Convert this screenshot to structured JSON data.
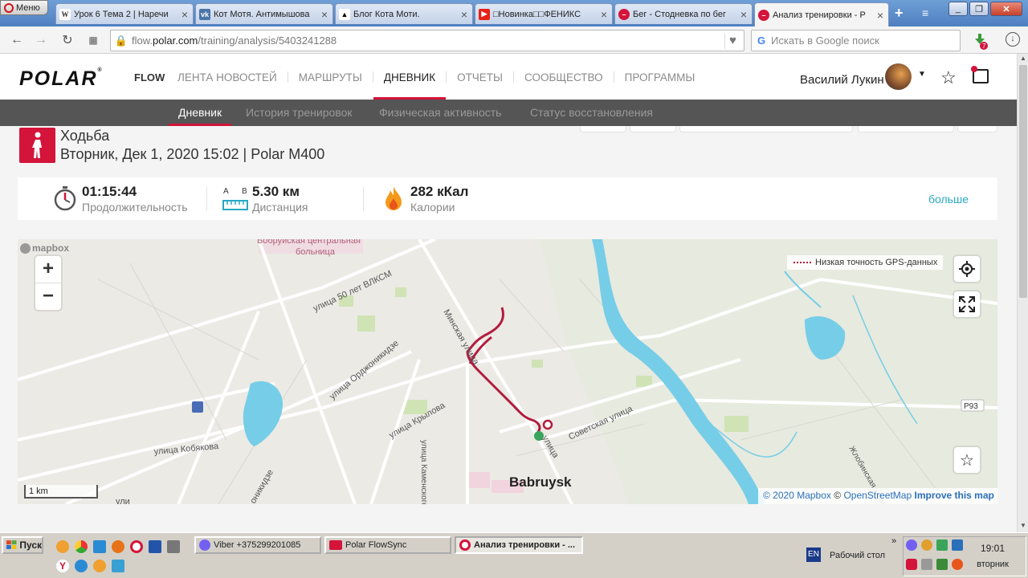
{
  "browser": {
    "menu_label": "Меню",
    "tabs": [
      {
        "title": "Урок 6 Тема 2 | Наречи",
        "icon": "wikipedia-icon"
      },
      {
        "title": "Кот Мотя. Антимышова",
        "icon": "vk-icon"
      },
      {
        "title": "Блог Кота Моти.",
        "icon": "cat-icon"
      },
      {
        "title": "□Новинка□□ФЕНИКС",
        "icon": "youtube-icon"
      },
      {
        "title": "Бег - Стодневка по бег",
        "icon": "red-circle-icon"
      },
      {
        "title": "Анализ тренировки - Р",
        "icon": "polar-icon"
      }
    ],
    "url_prefix": "flow.",
    "url_domain": "polar.com",
    "url_path": "/training/analysis/5403241288",
    "search_placeholder": "Искать в Google поиск"
  },
  "site": {
    "logo_text": "POLAR",
    "flow_label": "FLOW",
    "nav": [
      {
        "label": "ЛЕНТА НОВОСТЕЙ",
        "active": false
      },
      {
        "label": "МАРШРУТЫ",
        "active": false
      },
      {
        "label": "ДНЕВНИК",
        "active": true
      },
      {
        "label": "ОТЧЕТЫ",
        "active": false
      },
      {
        "label": "СООБЩЕСТВО",
        "active": false
      },
      {
        "label": "ПРОГРАММЫ",
        "active": false
      }
    ],
    "user_name": "Василий Лукин",
    "subnav": [
      {
        "label": "Дневник",
        "active": true
      },
      {
        "label": "История тренировок",
        "active": false
      },
      {
        "label": "Физическая активность",
        "active": false
      },
      {
        "label": "Статус восстановления",
        "active": false
      }
    ]
  },
  "activity": {
    "sport": "Ходьба",
    "date_line": "Вторник, Дек 1, 2020 15:02 | Polar M400",
    "stats": [
      {
        "value": "01:15:44",
        "label": "Продолжительность",
        "icon": "stopwatch-icon"
      },
      {
        "value": "5.30 км",
        "label": "Дистанция",
        "icon": "ruler-icon"
      },
      {
        "value": "282 кКал",
        "label": "Калории",
        "icon": "flame-icon"
      }
    ],
    "more_label": "больше",
    "ruler_a": "A",
    "ruler_b": "B"
  },
  "map": {
    "attribution_logo": "mapbox",
    "legend": "Низкая точность GPS-данных",
    "scale": "1 km",
    "city": "Babruysk",
    "road_badge": "P93",
    "labels": [
      "Бобруйская центральная",
      "больница",
      "улица 50 лет ВЛКСМ",
      "улица Орджоникидзе",
      "улица Крылова",
      "улица Кобякова",
      "Минская улица",
      "улица Каменского",
      "Советская улица",
      "улица",
      "Жлобинская улица",
      "оникидзе",
      "ули"
    ],
    "attrib_year": "© 2020 Mapbox",
    "attrib_osm": "OpenStreetMap",
    "attrib_improve": "Improve this map",
    "attrib_sep": "©"
  },
  "taskbar": {
    "start": "Пуск",
    "buttons": [
      {
        "label": "Viber +375299201085",
        "active": false
      },
      {
        "label": "Polar FlowSync",
        "active": false
      },
      {
        "label": "Анализ тренировки - ...",
        "active": true
      }
    ],
    "lang": "EN",
    "desktop": "Рабочий стол",
    "time": "19:01",
    "day": "вторник"
  }
}
